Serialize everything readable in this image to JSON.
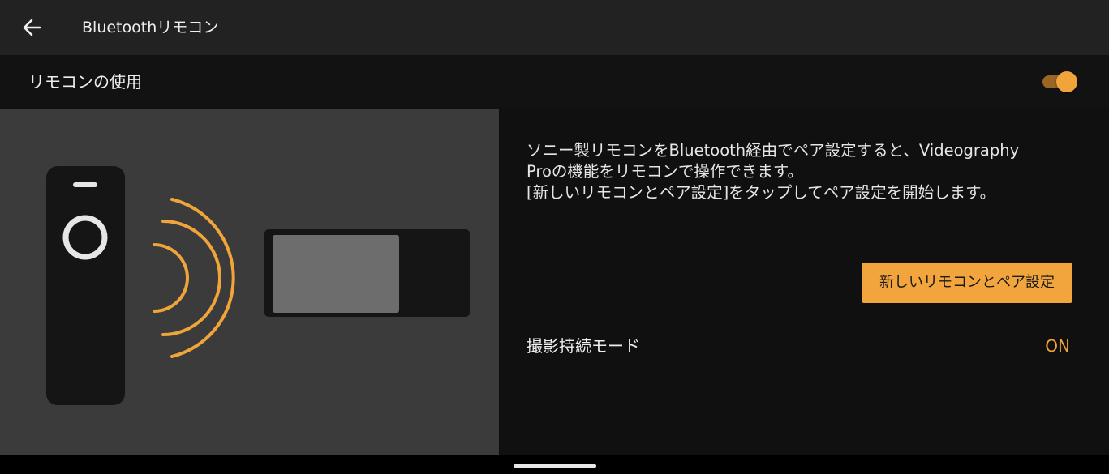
{
  "header": {
    "title": "Bluetoothリモコン",
    "back_icon": "arrow-left-icon"
  },
  "use_remote": {
    "label": "リモコンの使用",
    "enabled": true
  },
  "illustration": {
    "remote_icon": "remote-control-icon",
    "signal_icon": "bluetooth-signal-waves-icon",
    "device_icon": "phone-device-icon"
  },
  "description": {
    "lines": [
      "ソニー製リモコンをBluetooth経由でペア設定すると、Videography",
      "Proの機能をリモコンで操作できます。",
      "[新しいリモコンとペア設定]をタップしてペア設定を開始します。"
    ]
  },
  "pair_button": {
    "label": "新しいリモコンとペア設定"
  },
  "continuous_mode": {
    "label": "撮影持続モード",
    "value": "ON"
  },
  "colors": {
    "accent": "#f3a53d",
    "topbar": "#222222",
    "illustration_bg": "#3b3b3b",
    "panel_bg": "#101010"
  }
}
